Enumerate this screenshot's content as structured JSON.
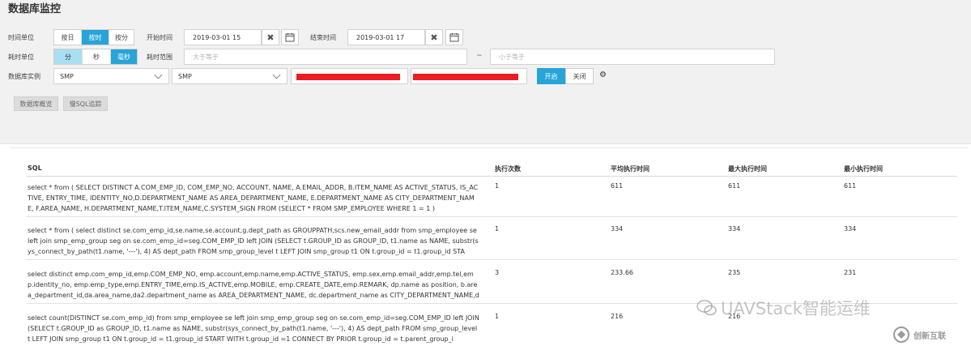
{
  "page": {
    "title": "数据库监控"
  },
  "filters": {
    "time_unit": {
      "label": "时间单位",
      "options": [
        "按日",
        "按时",
        "按分"
      ],
      "selected": "按时"
    },
    "start_time": {
      "label": "开始时间",
      "value": "2019-03-01 15"
    },
    "end_time": {
      "label": "结束时间",
      "value": "2019-03-01 17"
    },
    "elapsed_unit": {
      "label": "耗时单位",
      "options": [
        "分",
        "秒",
        "毫秒"
      ],
      "selected": "毫秒"
    },
    "elapsed_range": {
      "label": "耗时范围",
      "min_placeholder": "大于等于",
      "separator": "~",
      "max_placeholder": "小于等于"
    },
    "db_instance": {
      "label": "数据库实例",
      "select1": "SMP",
      "select2": "SMP"
    },
    "toggle": {
      "on_label": "开启",
      "off_label": "关闭"
    }
  },
  "actions": {
    "overview": "数据库概览",
    "slow_sql": "慢SQL追踪"
  },
  "table": {
    "columns": [
      "SQL",
      "执行次数",
      "平均执行时间",
      "最大执行时间",
      "最小执行时间"
    ],
    "rows": [
      {
        "sql": "select * from ( SELECT DISTINCT A.COM_EMP_ID, COM_EMP_NO, ACCOUNT, NAME, A.EMAIL_ADDR, B.ITEM_NAME AS ACTIVE_STATUS, IS_ACTIVE, ENTRY_TIME, IDENTITY_NO,D.DEPARTMENT_NAME AS AREA_DEPARTMENT_NAME, E.DEPARTMENT_NAME AS CITY_DEPARTMENT_NAME, F.AREA_NAME, H.DEPARTMENT_NAME,T.ITEM_NAME,C.SYSTEM_SIGN FROM (SELECT * FROM SMP_EMPLOYEE WHERE 1 = 1 )",
        "count": "1",
        "avg": "611",
        "max": "611",
        "min": "611"
      },
      {
        "sql": "select * from ( select distinct se.com_emp_id,se.name,se.account,g.dept_path as GROUPPATH,scs.new_email_addr from smp_employee se left join smp_emp_group seg on se.com_emp_id=seg.COM_EMP_ID left JOIN (SELECT t.GROUP_ID as GROUP_ID, t1.name as NAME, substr(sys_connect_by_path(t1.name, '---'), 4) AS dept_path FROM smp_group_level t LEFT JOIN smp_group t1 ON t.group_id = t1.group_id STA",
        "count": "1",
        "avg": "334",
        "max": "334",
        "min": "334"
      },
      {
        "sql": "select distinct emp.com_emp_id,emp.COM_EMP_NO, emp.account,emp.name,emp.ACTIVE_STATUS, emp.sex,emp.email_addr,emp.tel,emp.identity_no, emp.emp_type,emp.ENTRY_TIME,emp.IS_ACTIVE,emp.MOBILE, emp.CREATE_DATE,emp.REMARK, dp.name as position, b.area_department_id,da.area_name,da2.department_name as AREA_DEPARTMENT_NAME, dc.department_name as CITY_DEPARTMENT_NAME,d",
        "count": "3",
        "avg": "233.66",
        "max": "235",
        "min": "231"
      },
      {
        "sql": "select count(DISTINCT se.com_emp_id) from smp_employee se left join smp_emp_group seg on se.com_emp_id=seg.COM_EMP_ID left JOIN (SELECT t.GROUP_ID as GROUP_ID, t1.name as NAME, substr(sys_connect_by_path(t1.name, '---'), 4) AS dept_path FROM smp_group_level t LEFT JOIN smp_group t1 ON t.group_id = t1.group_id START WITH t.group_id =1 CONNECT BY PRIOR t.group_id = t.parent_group_i",
        "count": "1",
        "avg": "216",
        "max": "216",
        "min": ""
      }
    ]
  },
  "watermark": {
    "text": "UAVStack智能运维",
    "logo_text": "创新互联"
  },
  "colors": {
    "accent": "#27a4d8",
    "accent_light": "#a8dff2",
    "redaction": "#ec1c24"
  }
}
